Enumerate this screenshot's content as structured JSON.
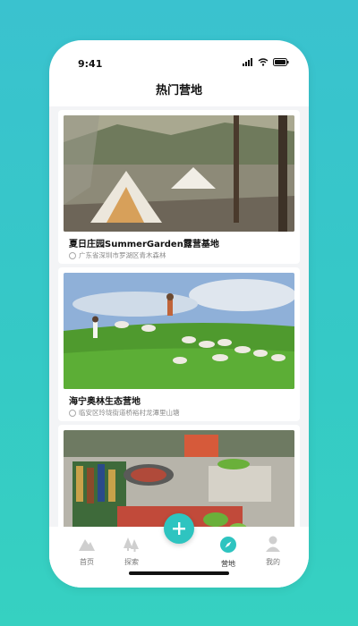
{
  "status": {
    "time": "9:41"
  },
  "page": {
    "title": "热门营地"
  },
  "camps": [
    {
      "name": "夏日庄园SummerGarden露营基地",
      "address": "广东省深圳市罗湖区青木森林"
    },
    {
      "name": "海宁奥林生态营地",
      "address": "临安区玲珑街道桥裕村龙潭里山塘"
    },
    {
      "name": "",
      "address": ""
    }
  ],
  "tabbar": {
    "items": [
      {
        "label": "首页",
        "icon": "mountain-home-icon"
      },
      {
        "label": "探索",
        "icon": "trees-icon"
      },
      {
        "label": "",
        "icon": "plus-icon"
      },
      {
        "label": "营地",
        "icon": "compass-icon"
      },
      {
        "label": "我的",
        "icon": "person-icon"
      }
    ]
  },
  "colors": {
    "accent": "#2ec4c0",
    "background_top": "#3ac2cf",
    "background_bottom": "#36d1c1"
  }
}
